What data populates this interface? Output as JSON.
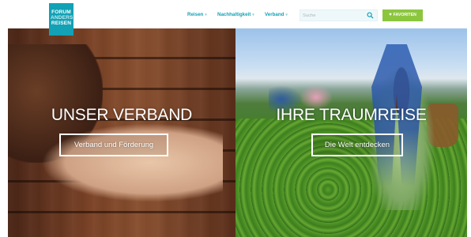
{
  "header": {
    "logo_lines": [
      "FORUM",
      "ANDERS",
      "REISEN"
    ],
    "nav": [
      {
        "label": "Reisen",
        "chevron": "chevron-down-icon"
      },
      {
        "label": "Nachhaltigkeit",
        "chevron": "chevron-down-icon"
      },
      {
        "label": "Verband",
        "chevron": "chevron-down-icon"
      }
    ],
    "search": {
      "placeholder": "Suche",
      "icon": "search-icon"
    },
    "favorites": {
      "label": "FAVORITEN",
      "icon": "heart-icon"
    }
  },
  "panels": {
    "left": {
      "title": "UNSER VERBAND",
      "button": "Verband und Förderung"
    },
    "right": {
      "title": "IHRE TRAUMREISE",
      "button": "Die Welt entdecken"
    }
  },
  "colors": {
    "brand_teal": "#12a1b5",
    "favorites_green": "#8cc63e",
    "search_bg": "#eef8fa"
  }
}
